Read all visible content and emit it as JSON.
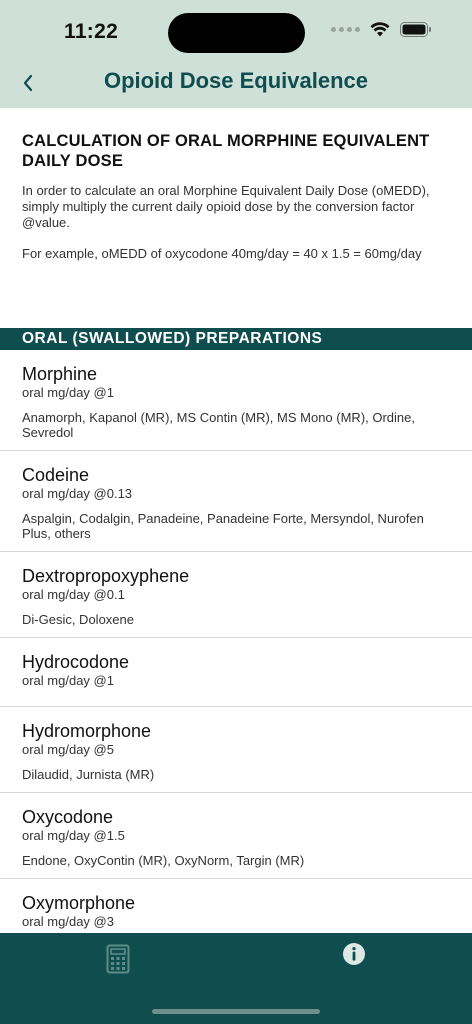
{
  "status_bar": {
    "time": "11:22"
  },
  "nav": {
    "title": "Opioid Dose Equivalence"
  },
  "intro": {
    "heading": "CALCULATION OF ORAL MORPHINE EQUIVALENT DAILY DOSE",
    "text": "In order to calculate an oral Morphine Equivalent Daily Dose (oMEDD), simply multiply the current daily opioid dose by the conversion factor @value.",
    "example": "For example, oMEDD of oxycodone 40mg/day = 40 x 1.5 = 60mg/day"
  },
  "section": {
    "title": "ORAL (SWALLOWED) PREPARATIONS"
  },
  "drugs": [
    {
      "name": "Morphine",
      "dose": "oral mg/day @1",
      "brands": "Anamorph, Kapanol (MR), MS Contin (MR), MS Mono (MR), Ordine, Sevredol"
    },
    {
      "name": "Codeine",
      "dose": "oral mg/day @0.13",
      "brands": "Aspalgin, Codalgin, Panadeine, Panadeine Forte, Mersyndol, Nurofen Plus, others"
    },
    {
      "name": "Dextropropoxyphene",
      "dose": "oral mg/day @0.1",
      "brands": "Di-Gesic, Doloxene"
    },
    {
      "name": "Hydrocodone",
      "dose": "oral mg/day @1",
      "brands": ""
    },
    {
      "name": "Hydromorphone",
      "dose": "oral mg/day @5",
      "brands": "Dilaudid, Jurnista (MR)"
    },
    {
      "name": "Oxycodone",
      "dose": "oral mg/day @1.5",
      "brands": "Endone, OxyContin (MR), OxyNorm, Targin (MR)"
    },
    {
      "name": "Oxymorphone",
      "dose": "oral mg/day @3",
      "brands": ""
    }
  ],
  "tabbar": {
    "tabs": [
      {
        "icon": "calculator-icon"
      },
      {
        "icon": "info-icon"
      }
    ]
  },
  "colors": {
    "header_bg": "#cfe0d8",
    "accent": "#0f4d4f"
  }
}
